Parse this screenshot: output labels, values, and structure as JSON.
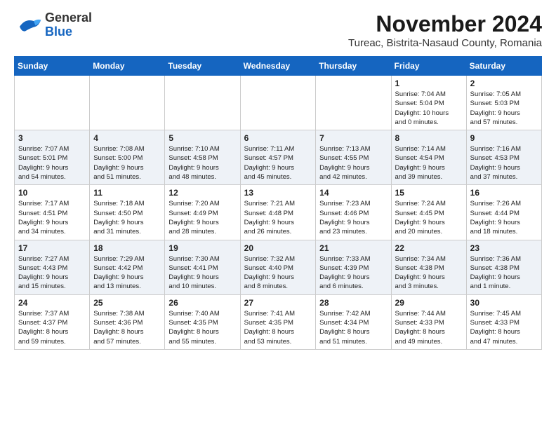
{
  "logo": {
    "line1": "General",
    "line2": "Blue"
  },
  "title": "November 2024",
  "subtitle": "Tureac, Bistrita-Nasaud County, Romania",
  "days_header": [
    "Sunday",
    "Monday",
    "Tuesday",
    "Wednesday",
    "Thursday",
    "Friday",
    "Saturday"
  ],
  "weeks": [
    [
      {
        "day": "",
        "info": ""
      },
      {
        "day": "",
        "info": ""
      },
      {
        "day": "",
        "info": ""
      },
      {
        "day": "",
        "info": ""
      },
      {
        "day": "",
        "info": ""
      },
      {
        "day": "1",
        "info": "Sunrise: 7:04 AM\nSunset: 5:04 PM\nDaylight: 10 hours\nand 0 minutes."
      },
      {
        "day": "2",
        "info": "Sunrise: 7:05 AM\nSunset: 5:03 PM\nDaylight: 9 hours\nand 57 minutes."
      }
    ],
    [
      {
        "day": "3",
        "info": "Sunrise: 7:07 AM\nSunset: 5:01 PM\nDaylight: 9 hours\nand 54 minutes."
      },
      {
        "day": "4",
        "info": "Sunrise: 7:08 AM\nSunset: 5:00 PM\nDaylight: 9 hours\nand 51 minutes."
      },
      {
        "day": "5",
        "info": "Sunrise: 7:10 AM\nSunset: 4:58 PM\nDaylight: 9 hours\nand 48 minutes."
      },
      {
        "day": "6",
        "info": "Sunrise: 7:11 AM\nSunset: 4:57 PM\nDaylight: 9 hours\nand 45 minutes."
      },
      {
        "day": "7",
        "info": "Sunrise: 7:13 AM\nSunset: 4:55 PM\nDaylight: 9 hours\nand 42 minutes."
      },
      {
        "day": "8",
        "info": "Sunrise: 7:14 AM\nSunset: 4:54 PM\nDaylight: 9 hours\nand 39 minutes."
      },
      {
        "day": "9",
        "info": "Sunrise: 7:16 AM\nSunset: 4:53 PM\nDaylight: 9 hours\nand 37 minutes."
      }
    ],
    [
      {
        "day": "10",
        "info": "Sunrise: 7:17 AM\nSunset: 4:51 PM\nDaylight: 9 hours\nand 34 minutes."
      },
      {
        "day": "11",
        "info": "Sunrise: 7:18 AM\nSunset: 4:50 PM\nDaylight: 9 hours\nand 31 minutes."
      },
      {
        "day": "12",
        "info": "Sunrise: 7:20 AM\nSunset: 4:49 PM\nDaylight: 9 hours\nand 28 minutes."
      },
      {
        "day": "13",
        "info": "Sunrise: 7:21 AM\nSunset: 4:48 PM\nDaylight: 9 hours\nand 26 minutes."
      },
      {
        "day": "14",
        "info": "Sunrise: 7:23 AM\nSunset: 4:46 PM\nDaylight: 9 hours\nand 23 minutes."
      },
      {
        "day": "15",
        "info": "Sunrise: 7:24 AM\nSunset: 4:45 PM\nDaylight: 9 hours\nand 20 minutes."
      },
      {
        "day": "16",
        "info": "Sunrise: 7:26 AM\nSunset: 4:44 PM\nDaylight: 9 hours\nand 18 minutes."
      }
    ],
    [
      {
        "day": "17",
        "info": "Sunrise: 7:27 AM\nSunset: 4:43 PM\nDaylight: 9 hours\nand 15 minutes."
      },
      {
        "day": "18",
        "info": "Sunrise: 7:29 AM\nSunset: 4:42 PM\nDaylight: 9 hours\nand 13 minutes."
      },
      {
        "day": "19",
        "info": "Sunrise: 7:30 AM\nSunset: 4:41 PM\nDaylight: 9 hours\nand 10 minutes."
      },
      {
        "day": "20",
        "info": "Sunrise: 7:32 AM\nSunset: 4:40 PM\nDaylight: 9 hours\nand 8 minutes."
      },
      {
        "day": "21",
        "info": "Sunrise: 7:33 AM\nSunset: 4:39 PM\nDaylight: 9 hours\nand 6 minutes."
      },
      {
        "day": "22",
        "info": "Sunrise: 7:34 AM\nSunset: 4:38 PM\nDaylight: 9 hours\nand 3 minutes."
      },
      {
        "day": "23",
        "info": "Sunrise: 7:36 AM\nSunset: 4:38 PM\nDaylight: 9 hours\nand 1 minute."
      }
    ],
    [
      {
        "day": "24",
        "info": "Sunrise: 7:37 AM\nSunset: 4:37 PM\nDaylight: 8 hours\nand 59 minutes."
      },
      {
        "day": "25",
        "info": "Sunrise: 7:38 AM\nSunset: 4:36 PM\nDaylight: 8 hours\nand 57 minutes."
      },
      {
        "day": "26",
        "info": "Sunrise: 7:40 AM\nSunset: 4:35 PM\nDaylight: 8 hours\nand 55 minutes."
      },
      {
        "day": "27",
        "info": "Sunrise: 7:41 AM\nSunset: 4:35 PM\nDaylight: 8 hours\nand 53 minutes."
      },
      {
        "day": "28",
        "info": "Sunrise: 7:42 AM\nSunset: 4:34 PM\nDaylight: 8 hours\nand 51 minutes."
      },
      {
        "day": "29",
        "info": "Sunrise: 7:44 AM\nSunset: 4:33 PM\nDaylight: 8 hours\nand 49 minutes."
      },
      {
        "day": "30",
        "info": "Sunrise: 7:45 AM\nSunset: 4:33 PM\nDaylight: 8 hours\nand 47 minutes."
      }
    ]
  ]
}
